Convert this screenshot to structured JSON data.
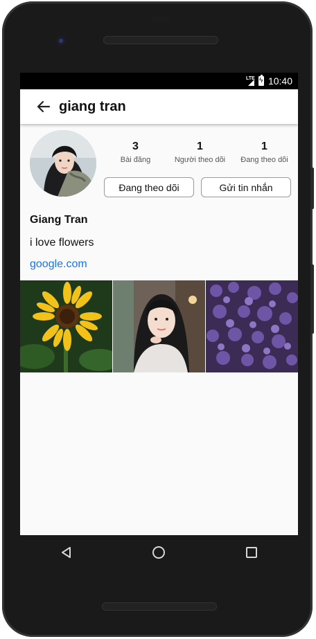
{
  "status_bar": {
    "network": "LTE",
    "time": "10:40"
  },
  "app_bar": {
    "back_icon": "arrow-back-icon",
    "title": "giang tran"
  },
  "profile": {
    "stats": [
      {
        "value": "3",
        "label": "Bài đăng"
      },
      {
        "value": "1",
        "label": "Người theo dõi"
      },
      {
        "value": "1",
        "label": "Đang theo dõi"
      }
    ],
    "follow_button": "Đang theo dõi",
    "message_button": "Gửi tin nhắn",
    "display_name": "Giang Tran",
    "bio": "i love flowers",
    "website": "google.com"
  },
  "posts": [
    {
      "subject": "sunflower"
    },
    {
      "subject": "portrait"
    },
    {
      "subject": "purple lilac flowers"
    }
  ],
  "nav_bar": {
    "back": "triangle-back-icon",
    "home": "circle-home-icon",
    "recents": "square-recents-icon"
  },
  "colors": {
    "link": "#1a73e8",
    "background": "#fafafa",
    "appbar": "#ffffff"
  }
}
